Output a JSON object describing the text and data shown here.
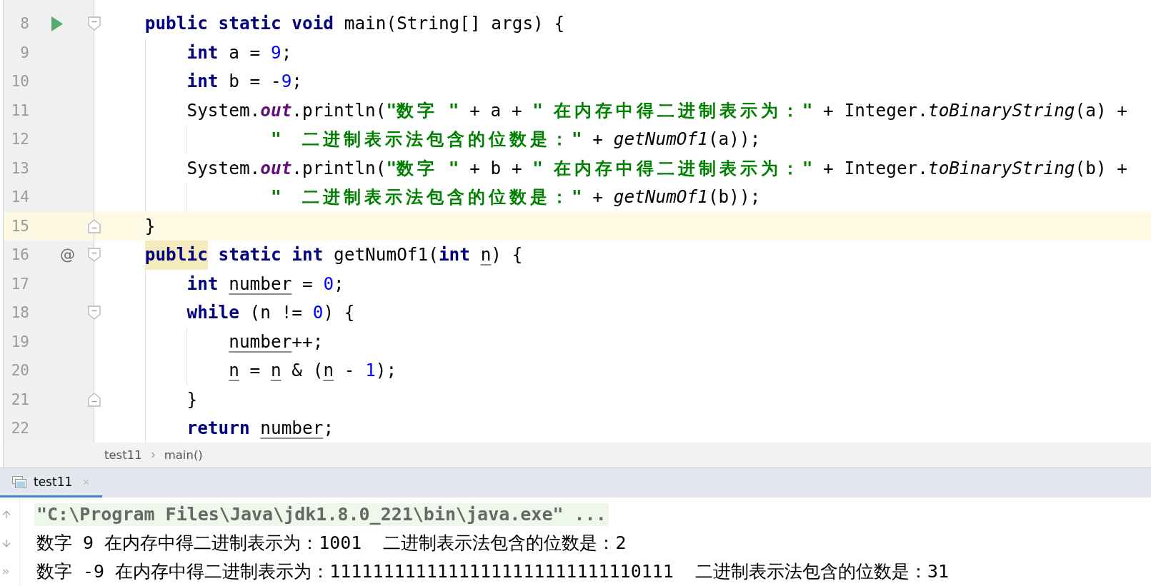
{
  "editor": {
    "lines": [
      {
        "number": "8",
        "kind": "statement",
        "caret": false,
        "run": true,
        "fold_start": true,
        "fold_end": false,
        "tokens": [
          {
            "kind": "keyword",
            "text": "public static void"
          },
          {
            "kind": "text",
            "text": " main(String[] args) {"
          }
        ],
        "children": [
          {
            "number": "9",
            "kind": "statement",
            "caret": false,
            "run": false,
            "fold_start": false,
            "fold_end": false,
            "tokens": [
              {
                "kind": "keyword",
                "text": "int"
              },
              {
                "kind": "text",
                "text": " a = "
              },
              {
                "kind": "number",
                "text": "9"
              },
              {
                "kind": "text",
                "text": ";"
              }
            ]
          },
          {
            "number": "10",
            "kind": "statement",
            "caret": false,
            "run": false,
            "fold_start": false,
            "fold_end": false,
            "tokens": [
              {
                "kind": "keyword",
                "text": "int"
              },
              {
                "kind": "text",
                "text": " b = -"
              },
              {
                "kind": "number",
                "text": "9"
              },
              {
                "kind": "text",
                "text": ";"
              }
            ]
          },
          {
            "number": "11",
            "kind": "statement",
            "caret": false,
            "run": false,
            "fold_start": false,
            "fold_end": false,
            "tokens": [
              {
                "kind": "text",
                "text": "System."
              },
              {
                "kind": "field",
                "text": "out"
              },
              {
                "kind": "text",
                "text": ".println("
              },
              {
                "kind": "string",
                "text": "\"数字 \""
              },
              {
                "kind": "text",
                "text": " + a + "
              },
              {
                "kind": "string",
                "text": "\" 在内存中得二进制表示为：\""
              },
              {
                "kind": "text",
                "text": " + Integer."
              },
              {
                "kind": "italic",
                "text": "toBinaryString"
              },
              {
                "kind": "text",
                "text": "(a) +"
              }
            ],
            "children": [
              {
                "number": "12",
                "kind": "continuation",
                "caret": false,
                "run": false,
                "fold_start": false,
                "fold_end": false,
                "tokens": [
                  {
                    "kind": "string",
                    "text": "\"  二进制表示法包含的位数是：\""
                  },
                  {
                    "kind": "text",
                    "text": " + "
                  },
                  {
                    "kind": "italic",
                    "text": "getNumOf1"
                  },
                  {
                    "kind": "text",
                    "text": "(a));"
                  }
                ]
              }
            ]
          },
          {
            "number": "13",
            "kind": "statement",
            "caret": false,
            "run": false,
            "fold_start": false,
            "fold_end": false,
            "tokens": [
              {
                "kind": "text",
                "text": "System."
              },
              {
                "kind": "field",
                "text": "out"
              },
              {
                "kind": "text",
                "text": ".println("
              },
              {
                "kind": "string",
                "text": "\"数字 \""
              },
              {
                "kind": "text",
                "text": " + b + "
              },
              {
                "kind": "string",
                "text": "\" 在内存中得二进制表示为：\""
              },
              {
                "kind": "text",
                "text": " + Integer."
              },
              {
                "kind": "italic",
                "text": "toBinaryString"
              },
              {
                "kind": "text",
                "text": "(b) +"
              }
            ],
            "children": [
              {
                "number": "14",
                "kind": "continuation",
                "caret": false,
                "run": false,
                "fold_start": false,
                "fold_end": false,
                "tokens": [
                  {
                    "kind": "string",
                    "text": "\"  二进制表示法包含的位数是：\""
                  },
                  {
                    "kind": "text",
                    "text": " + "
                  },
                  {
                    "kind": "italic",
                    "text": "getNumOf1"
                  },
                  {
                    "kind": "text",
                    "text": "(b));"
                  }
                ]
              }
            ]
          }
        ]
      },
      {
        "number": "15",
        "kind": "statement",
        "caret": true,
        "run": false,
        "fold_start": false,
        "fold_end": true,
        "tokens": [
          {
            "kind": "text",
            "text": "}"
          }
        ]
      },
      {
        "number": "16",
        "kind": "statement",
        "caret": false,
        "run": false,
        "fold_start": true,
        "fold_end": false,
        "marker": "@",
        "tokens": [
          {
            "kind": "match",
            "text": "public"
          },
          {
            "kind": "keyword",
            "text": " static int"
          },
          {
            "kind": "text",
            "text": " getNumOf1("
          },
          {
            "kind": "keyword",
            "text": "int "
          },
          {
            "kind": "underlined",
            "text": "n"
          },
          {
            "kind": "text",
            "text": ") {"
          }
        ],
        "children": [
          {
            "number": "17",
            "kind": "statement",
            "caret": false,
            "run": false,
            "fold_start": false,
            "fold_end": false,
            "tokens": [
              {
                "kind": "keyword",
                "text": "int "
              },
              {
                "kind": "underlined",
                "text": "number"
              },
              {
                "kind": "text",
                "text": " = "
              },
              {
                "kind": "number",
                "text": "0"
              },
              {
                "kind": "text",
                "text": ";"
              }
            ]
          },
          {
            "number": "18",
            "kind": "statement",
            "caret": false,
            "run": false,
            "fold_start": true,
            "fold_end": false,
            "tokens": [
              {
                "kind": "keyword",
                "text": "while"
              },
              {
                "kind": "text",
                "text": " (n != "
              },
              {
                "kind": "number",
                "text": "0"
              },
              {
                "kind": "text",
                "text": ") {"
              }
            ],
            "children": [
              {
                "number": "19",
                "kind": "statement",
                "caret": false,
                "run": false,
                "fold_start": false,
                "fold_end": false,
                "tokens": [
                  {
                    "kind": "underlined",
                    "text": "number"
                  },
                  {
                    "kind": "text",
                    "text": "++;"
                  }
                ]
              },
              {
                "number": "20",
                "kind": "statement",
                "caret": false,
                "run": false,
                "fold_start": false,
                "fold_end": false,
                "tokens": [
                  {
                    "kind": "underlined",
                    "text": "n"
                  },
                  {
                    "kind": "text",
                    "text": " = "
                  },
                  {
                    "kind": "underlined",
                    "text": "n"
                  },
                  {
                    "kind": "text",
                    "text": " & ("
                  },
                  {
                    "kind": "underlined",
                    "text": "n"
                  },
                  {
                    "kind": "text",
                    "text": " - "
                  },
                  {
                    "kind": "number",
                    "text": "1"
                  },
                  {
                    "kind": "text",
                    "text": ");"
                  }
                ]
              }
            ]
          },
          {
            "number": "21",
            "kind": "statement",
            "caret": false,
            "run": false,
            "fold_start": false,
            "fold_end": true,
            "tokens": [
              {
                "kind": "text",
                "text": "}"
              }
            ]
          },
          {
            "number": "22",
            "kind": "statement",
            "caret": false,
            "run": false,
            "fold_start": false,
            "fold_end": false,
            "tokens": [
              {
                "kind": "keyword",
                "text": "return "
              },
              {
                "kind": "underlined",
                "text": "number"
              },
              {
                "kind": "text",
                "text": ";"
              }
            ]
          }
        ]
      }
    ]
  },
  "breadcrumbs": [
    {
      "label": "test11"
    },
    {
      "label": "main()"
    }
  ],
  "run_panel": {
    "tabs": [
      {
        "label": "test11",
        "selected": true
      }
    ],
    "console": [
      {
        "kind": "command",
        "text": "\"C:\\Program Files\\Java\\jdk1.8.0_221\\bin\\java.exe\" ..."
      },
      {
        "kind": "output",
        "text": "数字 9 在内存中得二进制表示为：1001  二进制表示法包含的位数是：2"
      },
      {
        "kind": "output",
        "text": "数字 -9 在内存中得二进制表示为：11111111111111111111111111110111  二进制表示法包含的位数是：31"
      }
    ]
  }
}
